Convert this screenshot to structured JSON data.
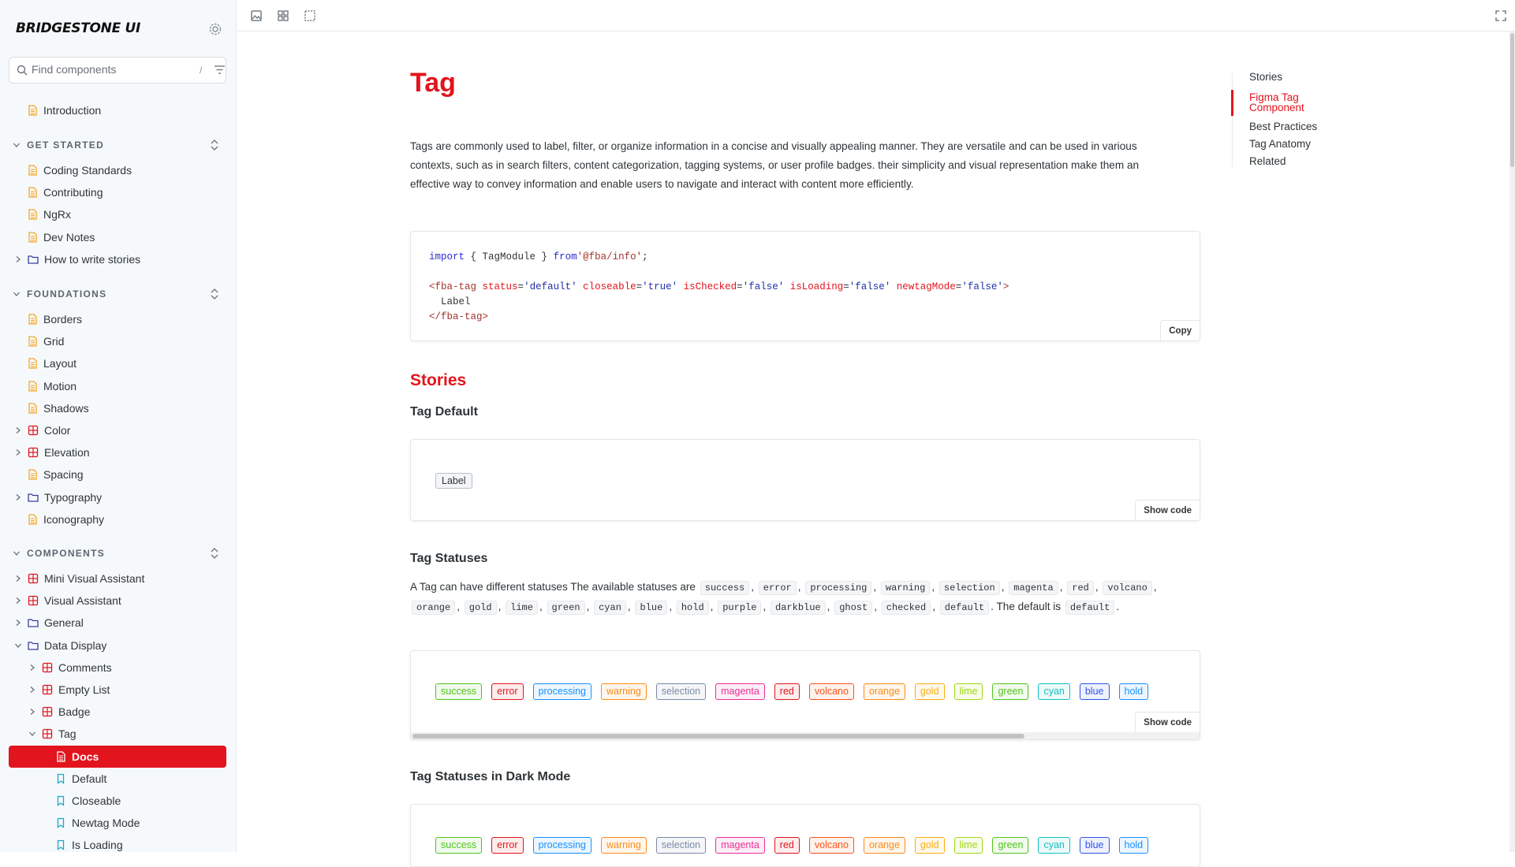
{
  "brand": "BRIDGESTONE UI",
  "search": {
    "placeholder": "Find components",
    "shortcut": "/"
  },
  "nav": {
    "introduction": "Introduction",
    "get_started": {
      "title": "GET STARTED",
      "items": [
        "Coding Standards",
        "Contributing",
        "NgRx",
        "Dev Notes",
        "How to write stories"
      ]
    },
    "foundations": {
      "title": "FOUNDATIONS",
      "items": [
        "Borders",
        "Grid",
        "Layout",
        "Motion",
        "Shadows",
        "Color",
        "Elevation",
        "Spacing",
        "Typography",
        "Iconography"
      ]
    },
    "components": {
      "title": "COMPONENTS",
      "items": [
        "Mini Visual Assistant",
        "Visual Assistant",
        "General",
        "Data Display",
        "Comments",
        "Empty List",
        "Badge",
        "Tag",
        "Docs",
        "Default",
        "Closeable",
        "Newtag Mode",
        "Is Loading"
      ]
    }
  },
  "page": {
    "title": "Tag",
    "intro": "Tags are commonly used to label, filter, or organize information in a concise and visually appealing manner. They are versatile and can be used in various contexts, such as in search filters, content categorization, tagging systems, or user profile badges. their simplicity and visual representation make them an effective way to convey information and enable users to navigate and interact with content more efficiently.",
    "import_code": {
      "kw_import": "import",
      "brace_open": " { ",
      "module": "TagModule",
      "brace_close": " } ",
      "kw_from": "from",
      "path": "'@fba/info'",
      "semi": ";",
      "tag_open": "<fba-tag",
      "attr1": "status",
      "val1": "'default'",
      "attr2": "closeable",
      "val2": "'true'",
      "attr3": "isChecked",
      "val3": "'false'",
      "attr4": "isLoading",
      "val4": "'false'",
      "attr5": "newtagMode",
      "val5": "'false'",
      "tag_open_end": ">",
      "label": "Label",
      "tag_close": "</fba-tag>"
    },
    "copy_label": "Copy",
    "stories_heading": "Stories",
    "tag_default_heading": "Tag Default",
    "tag_default_label": "Label",
    "show_code": "Show code",
    "tag_statuses_heading": "Tag Statuses",
    "statuses_text_prefix": "A Tag can have different statuses The available statuses are",
    "statuses_text_mid": ". The default is",
    "statuses_default": "default",
    "statuses_list": [
      "success",
      "error",
      "processing",
      "warning",
      "selection",
      "magenta",
      "red",
      "volcano",
      "orange",
      "gold",
      "lime",
      "green",
      "cyan",
      "blue",
      "hold",
      "purple",
      "darkblue",
      "ghost",
      "checked",
      "default"
    ],
    "dark_mode_heading": "Tag Statuses in Dark Mode",
    "tags": [
      {
        "label": "success",
        "color": "#52c41a"
      },
      {
        "label": "error",
        "color": "#e2141d"
      },
      {
        "label": "processing",
        "color": "#1890ff"
      },
      {
        "label": "warning",
        "color": "#fa8c16"
      },
      {
        "label": "selection",
        "color": "#7a8aa8"
      },
      {
        "label": "magenta",
        "color": "#eb2f96"
      },
      {
        "label": "red",
        "color": "#e2141d"
      },
      {
        "label": "volcano",
        "color": "#fa541c"
      },
      {
        "label": "orange",
        "color": "#fa8c16"
      },
      {
        "label": "gold",
        "color": "#faad14"
      },
      {
        "label": "lime",
        "color": "#a0d911"
      },
      {
        "label": "green",
        "color": "#52c41a"
      },
      {
        "label": "cyan",
        "color": "#13c2c2"
      },
      {
        "label": "blue",
        "color": "#2f54eb"
      },
      {
        "label": "hold",
        "color": "#1890ff"
      }
    ]
  },
  "toc": [
    "Stories",
    "Figma Tag Component",
    "Best Practices",
    "Tag Anatomy",
    "Related"
  ],
  "colors": {
    "accent": "#e2141d",
    "doc_icon": "#f5a623",
    "component_icon": "#e2141d",
    "folder_icon": "#3b3f9c",
    "story_icon": "#1ea7c5"
  }
}
